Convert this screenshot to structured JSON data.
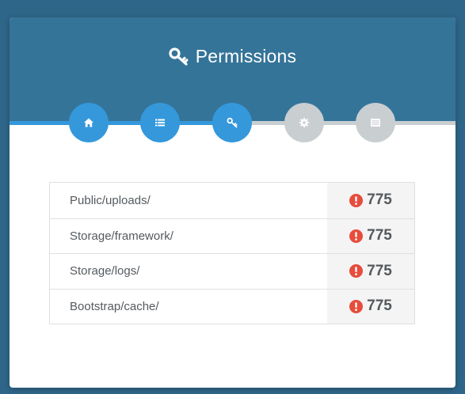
{
  "header": {
    "title": "Permissions",
    "title_icon": "key-icon"
  },
  "steps": [
    {
      "icon": "home-icon",
      "state": "done"
    },
    {
      "icon": "list-icon",
      "state": "done"
    },
    {
      "icon": "key-icon",
      "state": "done"
    },
    {
      "icon": "gear-icon",
      "state": "todo"
    },
    {
      "icon": "server-icon",
      "state": "todo"
    }
  ],
  "permissions": [
    {
      "path": "Public/uploads/",
      "value": "775",
      "status_icon": "alert-circle-icon"
    },
    {
      "path": "Storage/framework/",
      "value": "775",
      "status_icon": "alert-circle-icon"
    },
    {
      "path": "Storage/logs/",
      "value": "775",
      "status_icon": "alert-circle-icon"
    },
    {
      "path": "Bootstrap/cache/",
      "value": "775",
      "status_icon": "alert-circle-icon"
    }
  ],
  "colors": {
    "background": "#2e6689",
    "header": "#357499",
    "step_done": "#3498db",
    "step_todo": "#c9ced1",
    "alert": "#e74c3c"
  }
}
